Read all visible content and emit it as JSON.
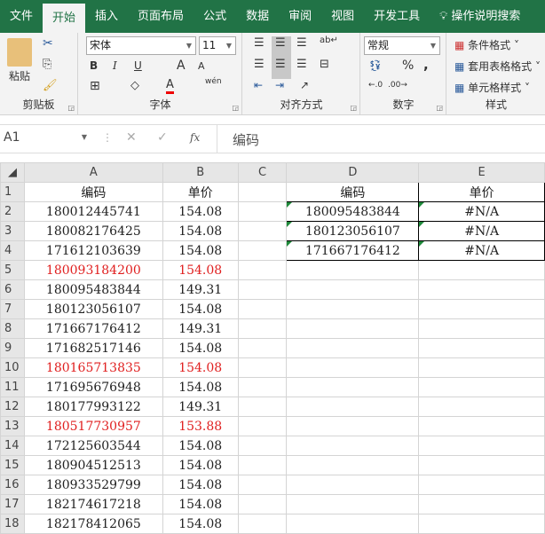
{
  "tabs": [
    "文件",
    "开始",
    "插入",
    "页面布局",
    "公式",
    "数据",
    "审阅",
    "视图",
    "开发工具"
  ],
  "tell_me": "操作说明搜索",
  "ribbon": {
    "clipboard": {
      "label": "剪贴板",
      "paste": "粘贴"
    },
    "font": {
      "label": "字体",
      "name": "宋体",
      "size": "11",
      "bold": "B",
      "italic": "I",
      "underline": "U",
      "grow": "A",
      "shrink": "A",
      "phonetic": "wén"
    },
    "alignment": {
      "label": "对齐方式"
    },
    "number": {
      "label": "数字",
      "format": "常规",
      "percent": "%",
      "comma": ","
    },
    "styles": {
      "label": "样式",
      "conditional": "条件格式",
      "table": "套用表格格式",
      "cell": "单元格样式"
    }
  },
  "formula_bar": {
    "name_box": "A1",
    "fx": "fx",
    "content": "编码"
  },
  "columns": [
    "A",
    "B",
    "C",
    "D",
    "E"
  ],
  "rows": [
    {
      "n": "1",
      "a": "编码",
      "b": "单价",
      "red": false
    },
    {
      "n": "2",
      "a": "180012445741",
      "b": "154.08",
      "red": false
    },
    {
      "n": "3",
      "a": "180082176425",
      "b": "154.08",
      "red": false
    },
    {
      "n": "4",
      "a": "171612103639",
      "b": "154.08",
      "red": false
    },
    {
      "n": "5",
      "a": "180093184200",
      "b": "154.08",
      "red": true
    },
    {
      "n": "6",
      "a": "180095483844",
      "b": "149.31",
      "red": false
    },
    {
      "n": "7",
      "a": "180123056107",
      "b": "154.08",
      "red": false
    },
    {
      "n": "8",
      "a": "171667176412",
      "b": "149.31",
      "red": false
    },
    {
      "n": "9",
      "a": "171682517146",
      "b": "154.08",
      "red": false
    },
    {
      "n": "10",
      "a": "180165713835",
      "b": "154.08",
      "red": true
    },
    {
      "n": "11",
      "a": "171695676948",
      "b": "154.08",
      "red": false
    },
    {
      "n": "12",
      "a": "180177993122",
      "b": "149.31",
      "red": false
    },
    {
      "n": "13",
      "a": "180517730957",
      "b": "153.88",
      "red": true
    },
    {
      "n": "14",
      "a": "172125603544",
      "b": "154.08",
      "red": false
    },
    {
      "n": "15",
      "a": "180904512513",
      "b": "154.08",
      "red": false
    },
    {
      "n": "16",
      "a": "180933529799",
      "b": "154.08",
      "red": false
    },
    {
      "n": "17",
      "a": "182174617218",
      "b": "154.08",
      "red": false
    },
    {
      "n": "18",
      "a": "182178412065",
      "b": "154.08",
      "red": false
    }
  ],
  "lookup": [
    {
      "d": "编码",
      "e": "单价"
    },
    {
      "d": "180095483844",
      "e": "#N/A"
    },
    {
      "d": "180123056107",
      "e": "#N/A"
    },
    {
      "d": "171667176412",
      "e": "#N/A"
    }
  ]
}
